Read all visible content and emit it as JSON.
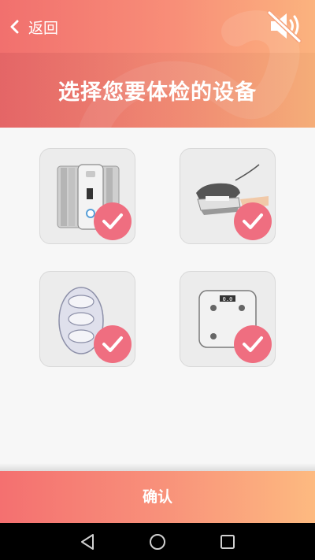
{
  "header": {
    "back_label": "返回",
    "title": "选择您要体检的设备",
    "back_icon": "chevron-left-icon",
    "mute_icon": "speaker-mute-icon"
  },
  "devices": [
    {
      "name": "blood-pressure-monitor",
      "icon": "blood-pressure-monitor-icon",
      "selected": true
    },
    {
      "name": "pulse-oximeter",
      "icon": "pulse-oximeter-icon",
      "selected": true
    },
    {
      "name": "egg-shaped-device",
      "icon": "oval-device-icon",
      "selected": true
    },
    {
      "name": "body-scale",
      "icon": "scale-icon",
      "selected": true,
      "scale_display": "0.0"
    }
  ],
  "footer": {
    "confirm_label": "确认"
  },
  "colors": {
    "accent": "#ef6e80",
    "header_start": "#f1706e",
    "header_end": "#fbb37e"
  },
  "android_nav": [
    "back-triangle-icon",
    "home-circle-icon",
    "recents-square-icon"
  ]
}
